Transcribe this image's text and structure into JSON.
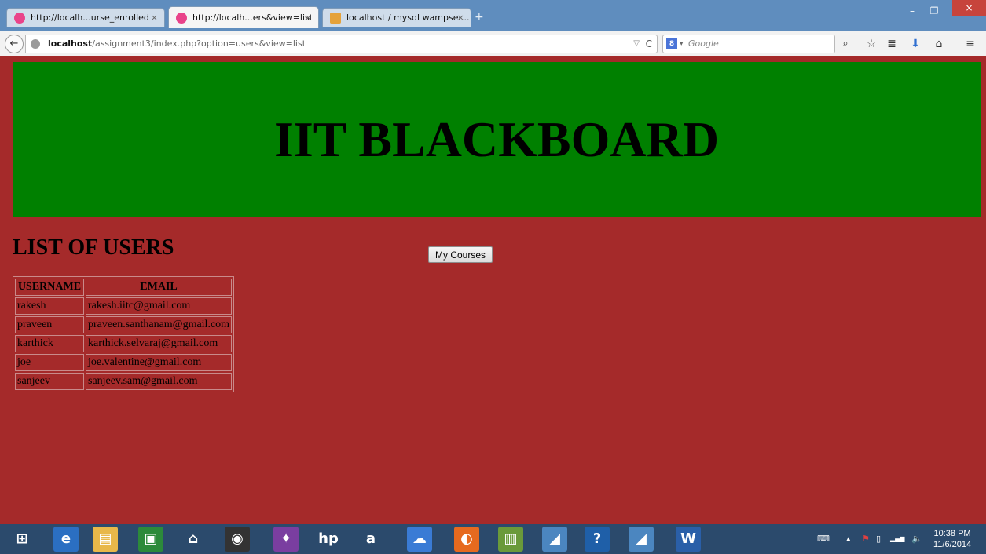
{
  "browser": {
    "tabs": [
      {
        "title": "http://localh...urse_enrolled",
        "close": "×"
      },
      {
        "title": "http://localh...ers&view=list",
        "close": "×"
      },
      {
        "title": "localhost / mysql wampser...",
        "close": "×"
      }
    ],
    "new_tab": "+",
    "window_controls": {
      "minimize": "–",
      "restore": "❐",
      "close": "×"
    },
    "url": {
      "host": "localhost",
      "path": "/assignment3/index.php?option=users&view=list"
    },
    "search_placeholder": "Google",
    "search_engine_letter": "8",
    "icons": {
      "back": "←",
      "dropdown": "▽",
      "reload": "C",
      "search_go": "⌕",
      "bookmark": "☆",
      "reading_list": "≣",
      "download": "⬇",
      "home": "⌂",
      "menu": "≡"
    }
  },
  "page": {
    "banner_title": "IIT BLACKBOARD",
    "list_heading": "LIST OF USERS",
    "my_courses_button": "My Courses",
    "table": {
      "headers": [
        "USERNAME",
        "EMAIL"
      ],
      "rows": [
        [
          "rakesh",
          "rakesh.iitc@gmail.com"
        ],
        [
          "praveen",
          "praveen.santhanam@gmail.com"
        ],
        [
          "karthick",
          "karthick.selvaraj@gmail.com"
        ],
        [
          "joe",
          "joe.valentine@gmail.com"
        ],
        [
          "sanjeev",
          "sanjeev.sam@gmail.com"
        ]
      ]
    }
  },
  "taskbar": {
    "items": [
      {
        "name": "windows-start-icon",
        "glyph": "⊞",
        "color": "#2b4a6c"
      },
      {
        "name": "internet-explorer-icon",
        "glyph": "e",
        "color": "#2b6fc2"
      },
      {
        "name": "file-explorer-icon",
        "glyph": "▤",
        "color": "#e8b84a"
      },
      {
        "name": "store-icon",
        "glyph": "▣",
        "color": "#2c8a3a"
      },
      {
        "name": "home-icon",
        "glyph": "⌂",
        "color": "#2b4a6c"
      },
      {
        "name": "webcam-icon",
        "glyph": "◉",
        "color": "#333333"
      },
      {
        "name": "photos-app-icon",
        "glyph": "✦",
        "color": "#7a3ea0"
      },
      {
        "name": "hp-icon",
        "glyph": "hp",
        "color": "#2b4a6c"
      },
      {
        "name": "amazon-icon",
        "glyph": "a",
        "color": "#2b4a6c"
      },
      {
        "name": "onedrive-icon",
        "glyph": "☁",
        "color": "#3a7bd5"
      },
      {
        "name": "firefox-icon",
        "glyph": "◐",
        "color": "#e66a1f"
      },
      {
        "name": "notepad-plus-icon",
        "glyph": "▥",
        "color": "#6a9a3a"
      },
      {
        "name": "app-blue-icon",
        "glyph": "◢",
        "color": "#4b86c0"
      },
      {
        "name": "help-icon",
        "glyph": "?",
        "color": "#1f5fa8"
      },
      {
        "name": "app-blue-icon-2",
        "glyph": "◢",
        "color": "#4b86c0"
      },
      {
        "name": "word-icon",
        "glyph": "W",
        "color": "#2a5fa8"
      }
    ],
    "tray": {
      "keyboard": "⌨",
      "show_hidden": "▴",
      "flag": "⚑",
      "battery": "▯",
      "signal": "▂▄▆",
      "volume": "🔈"
    },
    "clock": {
      "time": "10:38 PM",
      "date": "11/6/2014"
    }
  }
}
